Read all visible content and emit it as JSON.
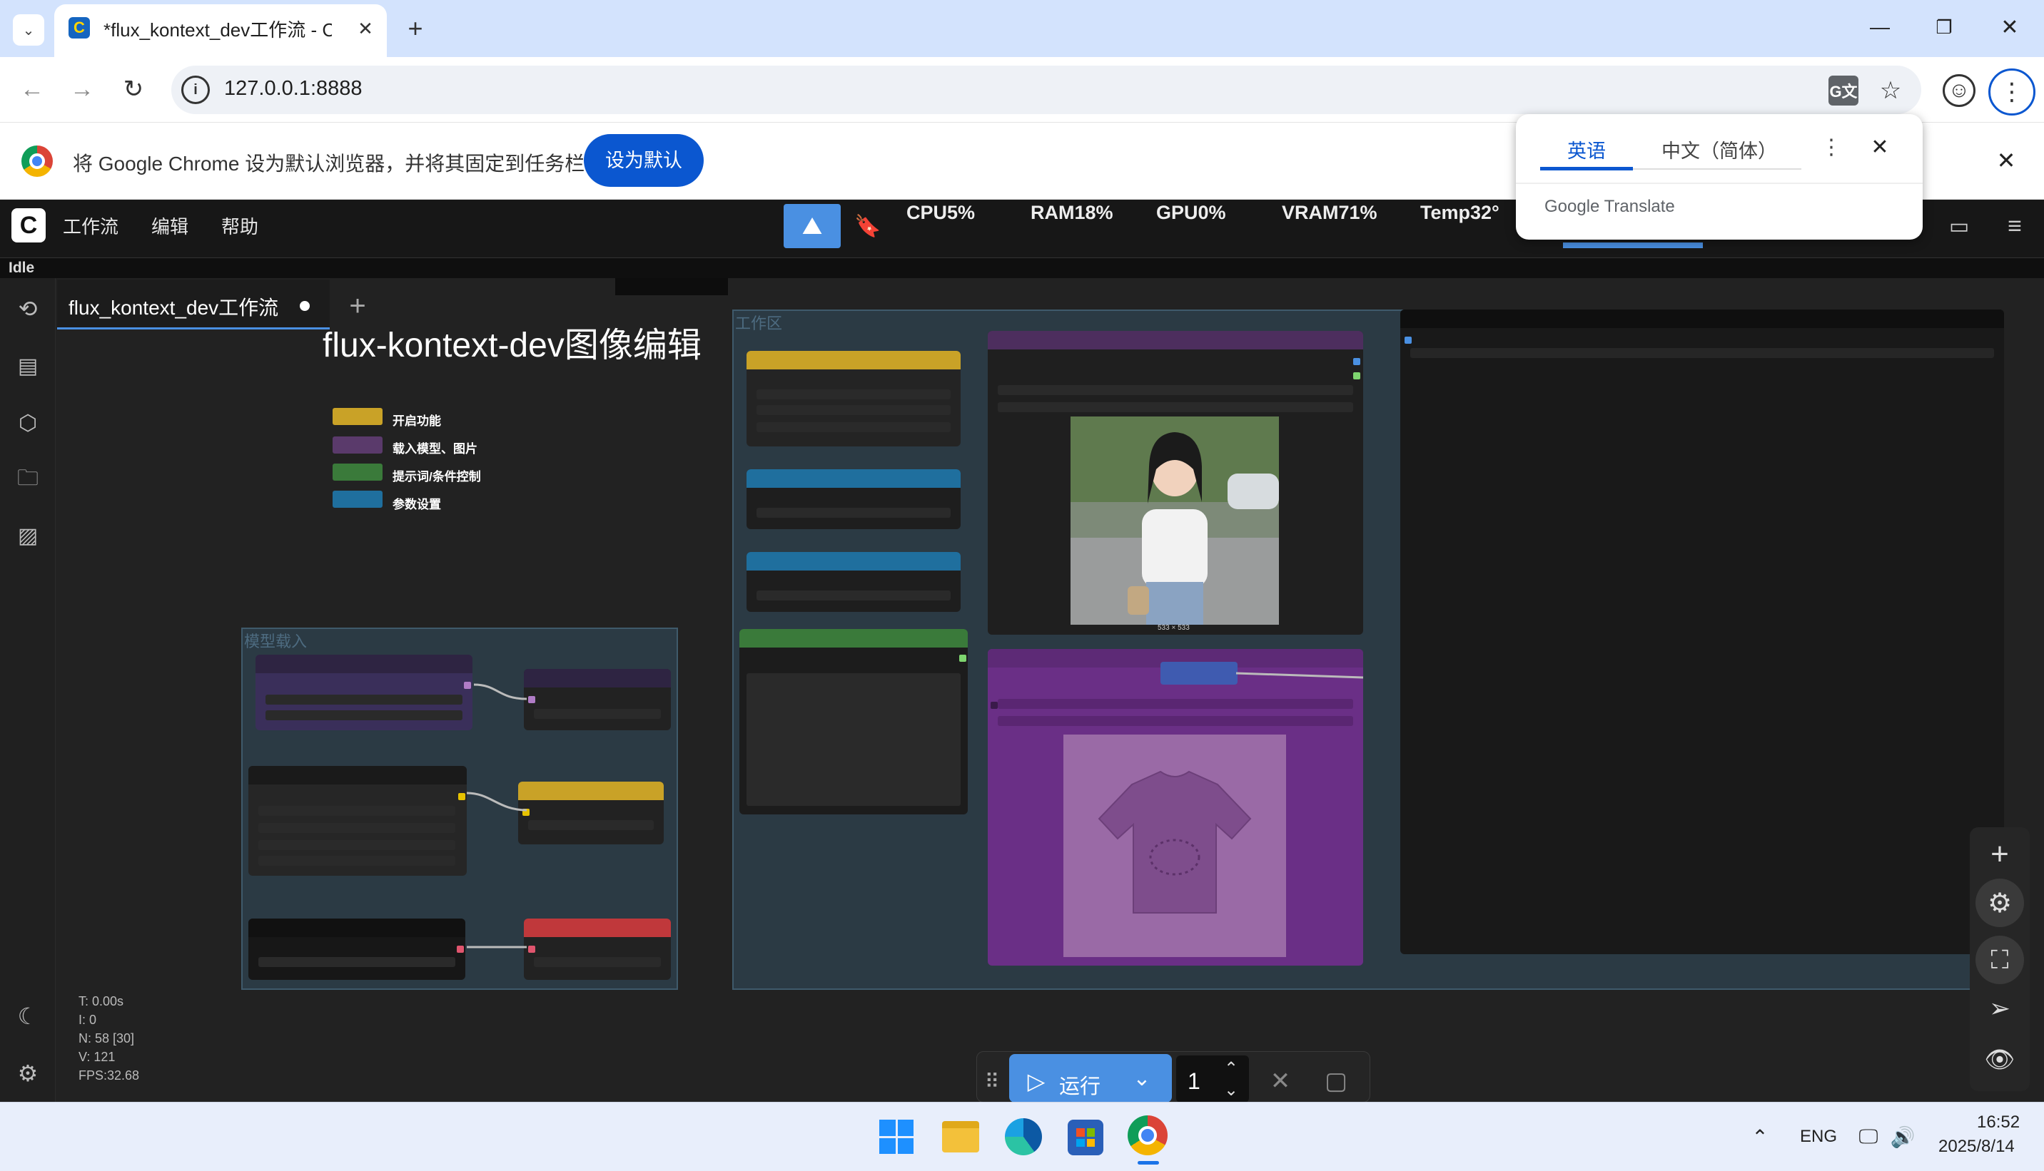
{
  "browser": {
    "tab_title": "*flux_kontext_dev工作流 - Co",
    "url": "127.0.0.1:8888",
    "infobar_text": "将 Google Chrome 设为默认浏览器，并将其固定到任务栏",
    "infobar_button": "设为默认"
  },
  "translate_popup": {
    "tab_source": "英语",
    "tab_target": "中文（简体）",
    "brand": "Google Translate"
  },
  "comfy": {
    "menu": [
      "工作流",
      "编辑",
      "帮助"
    ],
    "stats": {
      "cpu": "CPU5%",
      "ram": "RAM18%",
      "gpu": "GPU0%",
      "vram": "VRAM71%",
      "temp": "Temp32°"
    },
    "status": "Idle",
    "workflow_tab": "flux_kontext_dev工作流",
    "canvas_title": "flux-kontext-dev图像编辑",
    "legend": [
      {
        "label": "开启功能",
        "color": "#c9a227"
      },
      {
        "label": "载入模型、图片",
        "color": "#5a3a6b"
      },
      {
        "label": "提示词/条件控制",
        "color": "#3a7a3a"
      },
      {
        "label": "参数设置",
        "color": "#1f6f9e"
      }
    ],
    "group_model": "模型载入",
    "group_work": "工作区",
    "image_caption": "533 × 533",
    "stats_text": [
      "T: 0.00s",
      "I: 0",
      "N: 58 [30]",
      "V: 121",
      "FPS:32.68"
    ],
    "run_label": "运行",
    "queue_count": "1"
  },
  "taskbar": {
    "lang": "ENG",
    "time": "16:52",
    "date": "2025/8/14"
  },
  "colors": {
    "accent": "#0b57d0",
    "node_bg": "#353535",
    "group_bg": "#2b3a44"
  }
}
